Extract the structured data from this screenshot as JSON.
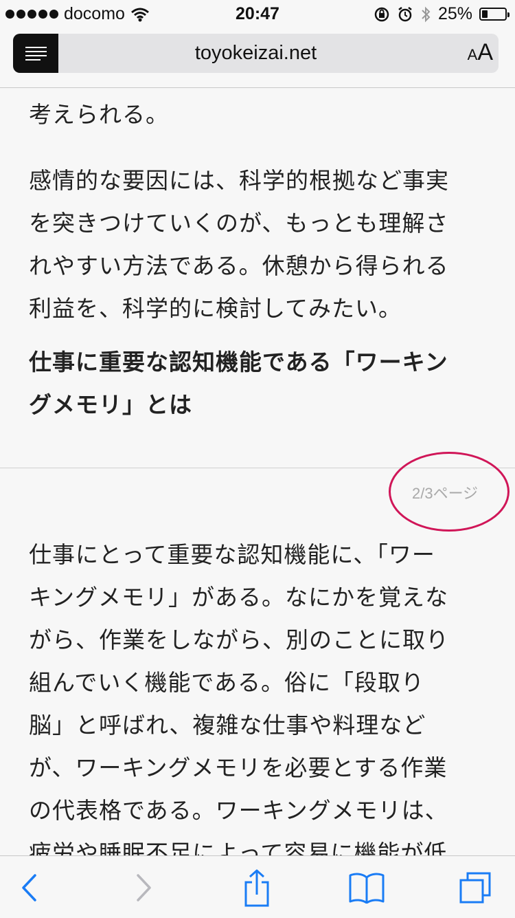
{
  "status": {
    "carrier": "docomo",
    "time": "20:47",
    "battery": "25%",
    "battery_level": 0.25
  },
  "urlbar": {
    "domain": "toyokeizai.net",
    "text_size_small": "A",
    "text_size_large": "A"
  },
  "article": {
    "p0": [
      "考えられる。"
    ],
    "p1": [
      "感情的な要因には、科学的根拠など事実",
      "を突きつけていくのが、もっとも理解さ",
      "れやすい方法である。休憩から得られる",
      "利益を、科学的に検討してみたい。"
    ],
    "heading": [
      "仕事に重要な認知機能である「ワーキン",
      "グメモリ」とは"
    ],
    "page_indicator": "2/3ページ",
    "p2": [
      "仕事にとって重要な認知機能に、「ワー",
      "キングメモリ」がある。なにかを覚えな",
      "がら、作業をしながら、別のことに取り",
      "組んでいく機能である。俗に「段取り",
      "脳」と呼ばれ、複雑な仕事や料理など",
      "が、ワーキングメモリを必要とする作業",
      "の代表格である。ワーキングメモリは、",
      "疲労や睡眠不足によって容易に機能が低"
    ]
  },
  "toolbar": {
    "back": "back-icon",
    "forward": "forward-icon",
    "share": "share-icon",
    "bookmarks": "bookmarks-icon",
    "tabs": "tabs-icon",
    "accent_color": "#1a7cf5",
    "disabled_color": "#b8b8bd"
  }
}
